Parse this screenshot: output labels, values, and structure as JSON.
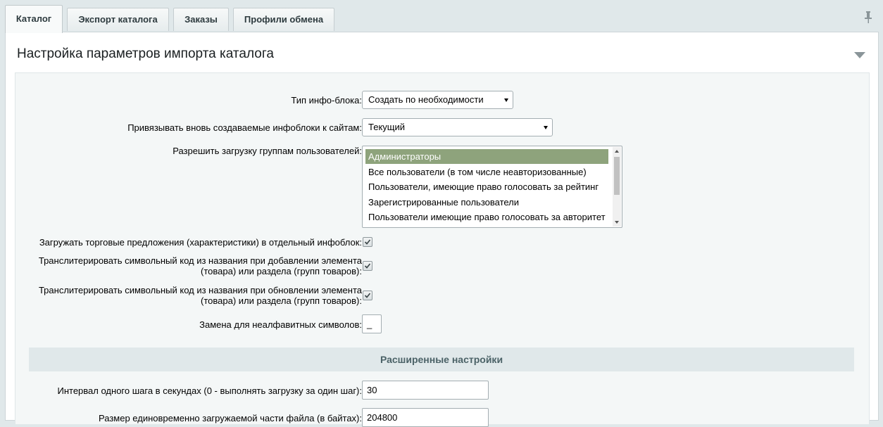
{
  "tabs": [
    {
      "label": "Каталог",
      "active": true
    },
    {
      "label": "Экспорт каталога",
      "active": false
    },
    {
      "label": "Заказы",
      "active": false
    },
    {
      "label": "Профили обмена",
      "active": false
    }
  ],
  "icons": {
    "pin": "pin-icon",
    "collapse": "triangle-down-icon",
    "check": "check-icon"
  },
  "panel": {
    "title": "Настройка параметров импорта каталога"
  },
  "form": {
    "iblock_type": {
      "label": "Тип инфо-блока:",
      "value": "Создать по необходимости"
    },
    "bind_sites": {
      "label": "Привязывать вновь создаваемые инфоблоки к сайтам:",
      "value": "Текущий"
    },
    "user_groups": {
      "label": "Разрешить загрузку группам пользователей:",
      "options": [
        "Администраторы",
        "Все пользователи (в том числе неавторизованные)",
        "Пользователи, имеющие право голосовать за рейтинг",
        "Зарегистрированные пользователи",
        "Пользователи имеющие право голосовать за авторитет"
      ],
      "selected": "Администраторы"
    },
    "offers_separate": {
      "label": "Загружать торговые предложения (характеристики) в отдельный инфоблок:",
      "checked": true
    },
    "translit_add": {
      "label_line1": "Транслитерировать символьный код из названия при добавлении элемента",
      "label_line2": "(товара) или раздела (групп товаров):",
      "checked": true
    },
    "translit_update": {
      "label_line1": "Транслитерировать символьный код из названия при обновлении элемента",
      "label_line2": "(товара) или раздела (групп товаров):",
      "checked": true
    },
    "replace_char": {
      "label": "Замена для неалфавитных символов:",
      "value": "_"
    }
  },
  "advanced": {
    "title": "Расширенные настройки",
    "interval": {
      "label": "Интервал одного шага в секундах (0 - выполнять загрузку за один шаг):",
      "value": "30"
    },
    "chunk_size": {
      "label": "Размер единовременно загружаемой части файла (в байтах):",
      "value": "204800"
    }
  },
  "colors": {
    "selected_option": "#8ea37c",
    "section_head": "#e0e8ea",
    "accent_text": "#4b6267"
  }
}
